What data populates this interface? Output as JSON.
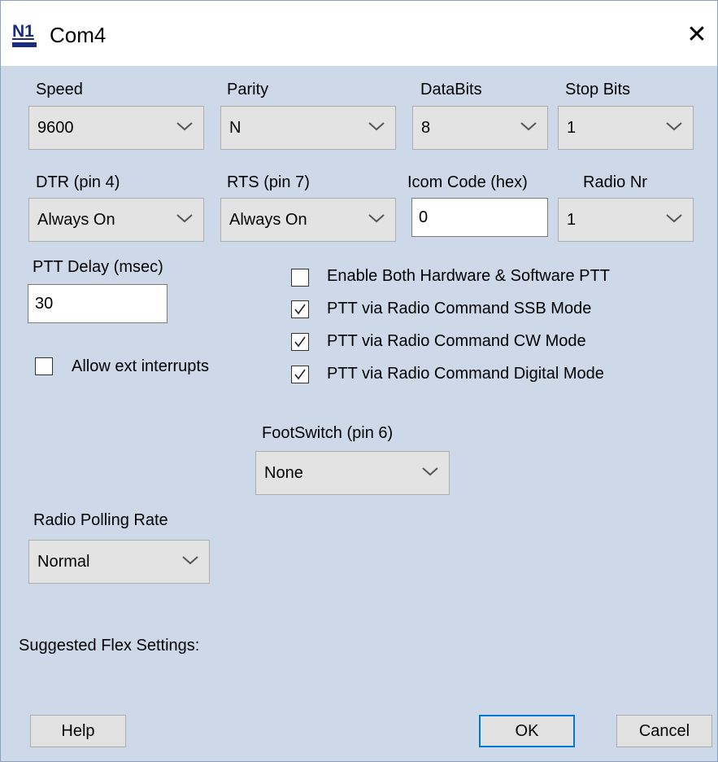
{
  "window": {
    "title": "Com4",
    "app_icon": "n1mm-logo",
    "close_glyph": "✕"
  },
  "serial": {
    "speed": {
      "label": "Speed",
      "value": "9600"
    },
    "parity": {
      "label": "Parity",
      "value": "N"
    },
    "databits": {
      "label": "DataBits",
      "value": "8"
    },
    "stopbits": {
      "label": "Stop Bits",
      "value": "1"
    },
    "dtr": {
      "label": "DTR (pin 4)",
      "value": "Always On"
    },
    "rts": {
      "label": "RTS (pin 7)",
      "value": "Always On"
    },
    "icom_code": {
      "label": "Icom Code (hex)",
      "value": "0"
    },
    "radio_nr": {
      "label": "Radio Nr",
      "value": "1"
    }
  },
  "ptt": {
    "delay_label": "PTT Delay  (msec)",
    "delay_value": "30",
    "allow_ext_interrupts": {
      "label": "Allow ext interrupts",
      "checked": false
    },
    "options": [
      {
        "label": "Enable Both Hardware & Software PTT",
        "checked": false
      },
      {
        "label": "PTT via Radio Command SSB Mode",
        "checked": true
      },
      {
        "label": "PTT via Radio Command CW Mode",
        "checked": true
      },
      {
        "label": "PTT via Radio Command Digital Mode",
        "checked": true
      }
    ]
  },
  "footswitch": {
    "label": "FootSwitch (pin 6)",
    "value": "None"
  },
  "polling": {
    "label": "Radio Polling Rate",
    "value": "Normal"
  },
  "flex": {
    "label": "Suggested Flex Settings:"
  },
  "buttons": {
    "help": "Help",
    "ok": "OK",
    "cancel": "Cancel"
  },
  "colors": {
    "dialog_bg": "#cdd9e9",
    "default_button_border": "#0078d7"
  }
}
